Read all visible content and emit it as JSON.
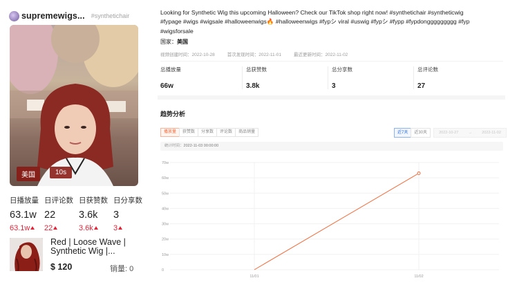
{
  "author": {
    "name": "supremewigs...",
    "tag": "#synthetichair"
  },
  "video": {
    "country_badge": "美国",
    "duration_badge": "10s",
    "description": "Looking for Synthetic Wig this upcoming Halloween? Check our TikTok shop right now! #synthetichair #syntheticwig #fypage #wigs #wigsale #halloweenwigs🔥 #halloweenwigs #fypシ viral #uswig #fypシ #fypp #fypdonggggggggg #fyp #wigsforsale",
    "country_label": "国家：",
    "country_value": "美国",
    "created": "视频创建时间：2022-10-28",
    "first_seen": "首次发现时间：2022-11-01",
    "last_updated": "最近更新时间：2022-11-02"
  },
  "daily": {
    "labels": [
      "日播放量",
      "日评论数",
      "日获赞数",
      "日分享数"
    ],
    "values": [
      "63.1w",
      "22",
      "3.6k",
      "3"
    ],
    "deltas": [
      "63.1w",
      "22",
      "3.6k",
      "3"
    ]
  },
  "product": {
    "title": "Red | Loose Wave | Synthetic Wig |...",
    "price": "$ 120",
    "sales": "销量: 0"
  },
  "totals": {
    "labels": [
      "总播放量",
      "总获赞数",
      "总分享数",
      "总评论数"
    ],
    "values": [
      "66w",
      "3.8k",
      "3",
      "27"
    ]
  },
  "trend": {
    "title": "趋势分析",
    "tabs": [
      "播放量",
      "获赞数",
      "分享数",
      "评论数",
      "商品销量"
    ],
    "active_tab": 0,
    "range_buttons": [
      "近7天",
      "近30天"
    ],
    "active_range": 0,
    "date_start": "2022-10-27",
    "date_sep": "→",
    "date_end": "2022-11-02",
    "tooltip_label": "统计时间：",
    "tooltip_value": "2022-11-03 00:00:00"
  },
  "colors": {
    "accent": "#f06a3a",
    "delta_up": "#e0243a",
    "range_active": "#2f6ee0"
  },
  "chart_data": {
    "type": "line",
    "title": "",
    "xlabel": "",
    "ylabel": "",
    "categories": [
      "11/01",
      "11/02"
    ],
    "series": [
      {
        "values": [
          0,
          630000
        ]
      }
    ],
    "ylim": [
      0,
      700000
    ],
    "y_ticks": [
      "0",
      "10w",
      "20w",
      "30w",
      "40w",
      "50w",
      "60w",
      "70w"
    ],
    "grid": true
  }
}
